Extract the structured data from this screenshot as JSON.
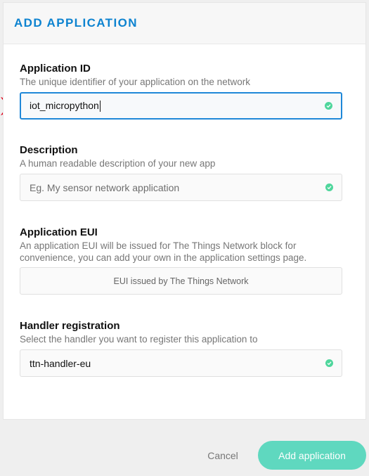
{
  "header": {
    "title": "ADD APPLICATION"
  },
  "fields": {
    "app_id": {
      "label": "Application ID",
      "description": "The unique identifier of your application on the network",
      "value": "iot_micropython"
    },
    "description": {
      "label": "Description",
      "description": "A human readable description of your new app",
      "placeholder": "Eg. My sensor network application"
    },
    "app_eui": {
      "label": "Application EUI",
      "description": "An application EUI will be issued for The Things Network block for convenience, you can add your own in the application settings page.",
      "value": "EUI issued by The Things Network"
    },
    "handler": {
      "label": "Handler registration",
      "description": "Select the handler you want to register this application to",
      "value": "ttn-handler-eu"
    }
  },
  "buttons": {
    "cancel": "Cancel",
    "submit": "Add application"
  },
  "colors": {
    "title": "#0d83d0",
    "focus_border": "#1f88d8",
    "valid_check": "#4fd69c",
    "primary_button": "#5fd8bf",
    "pointer_arrow": "#e0001b"
  }
}
